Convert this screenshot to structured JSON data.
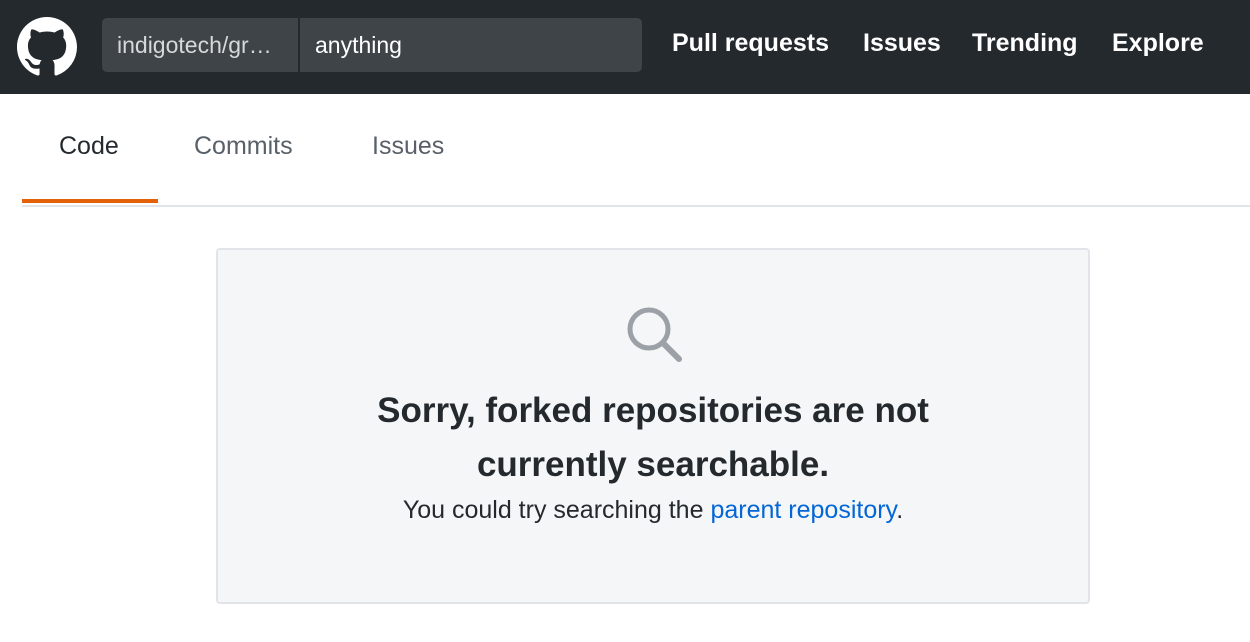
{
  "header": {
    "logo_icon": "github-octocat-icon",
    "search": {
      "scope": "indigotech/gr…",
      "value": "anything"
    },
    "nav": {
      "pull_requests": "Pull requests",
      "issues": "Issues",
      "trending": "Trending",
      "explore": "Explore"
    }
  },
  "tabs": {
    "code": "Code",
    "commits": "Commits",
    "issues": "Issues",
    "selected": "Code",
    "selected_color": "#e36209"
  },
  "blankslate": {
    "icon": "search-icon",
    "title_line1": "Sorry, forked repositories are not",
    "title_line2": "currently searchable.",
    "text_prefix": "You could try searching the",
    "link": "parent repository",
    "text_suffix": ".",
    "link_color": "#0366d6"
  },
  "colors": {
    "header_bg": "#24292e",
    "search_bg": "#3f4448"
  }
}
